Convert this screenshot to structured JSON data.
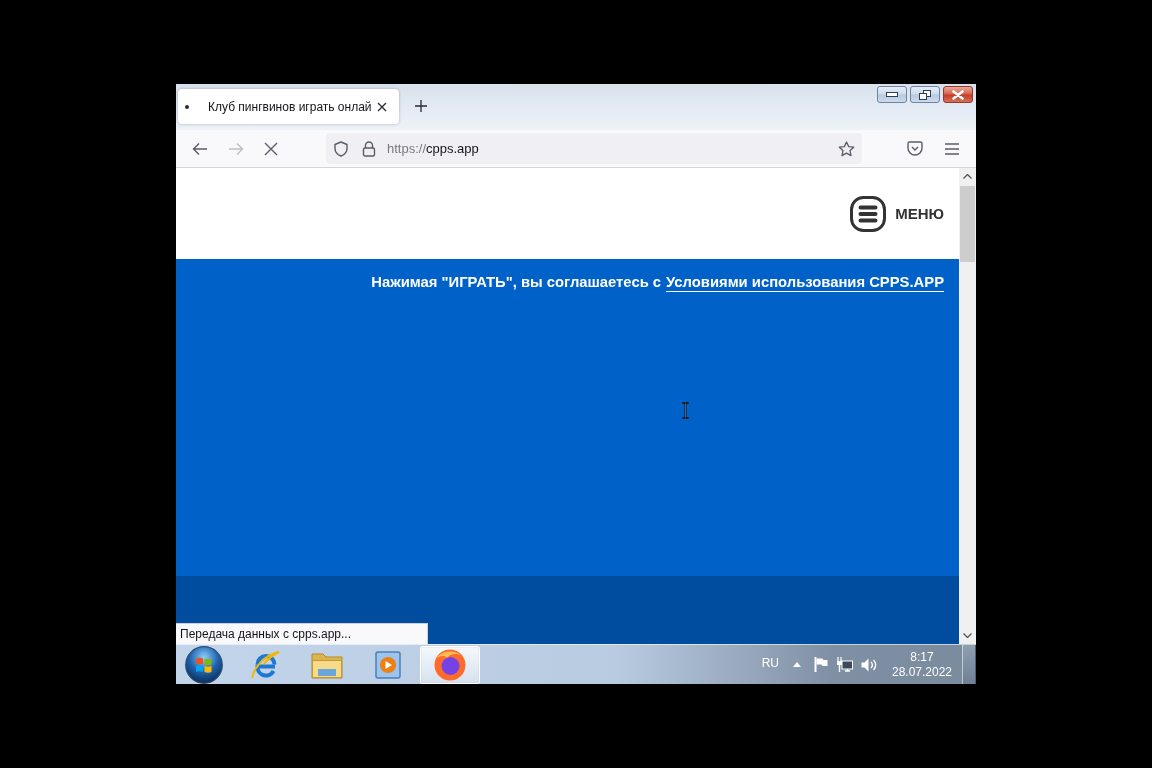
{
  "window": {
    "tabs": [
      {
        "title": "Клуб пингвинов играть онлай",
        "selected": true
      }
    ]
  },
  "toolbar": {
    "nav_buttons": [
      {
        "kind": "back",
        "disabled": false
      },
      {
        "kind": "forward",
        "disabled": true
      },
      {
        "kind": "stop",
        "disabled": false
      }
    ],
    "address": {
      "scheme": "https://",
      "host": "cpps.app"
    }
  },
  "page": {
    "menu_label": "МЕНЮ",
    "notice": {
      "text": "Нажимая \"ИГРАТЬ\", вы соглашаетесь с",
      "link": "Условиями использования CPPS.APP"
    }
  },
  "status_text": "Передача данных с cpps.app...",
  "taskbar": {
    "items": [
      {
        "kind": "e_browser",
        "selected": false
      },
      {
        "kind": "folder",
        "selected": false
      },
      {
        "kind": "media_player",
        "selected": false
      },
      {
        "kind": "fox_browser",
        "selected": true
      }
    ],
    "tray": {
      "language": "RU",
      "time": "8:17",
      "date": "28.07.2022"
    }
  }
}
